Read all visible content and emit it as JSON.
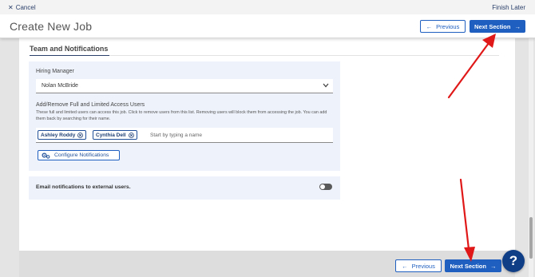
{
  "topbar": {
    "cancel_label": "Cancel",
    "finish_label": "Finish Later"
  },
  "header": {
    "title": "Create New Job",
    "previous_label": "Previous",
    "next_label": "Next Section"
  },
  "section": {
    "title": "Team and Notifications"
  },
  "hiring_manager": {
    "label": "Hiring Manager",
    "value": "Nolan McBride"
  },
  "access_users": {
    "label": "Add/Remove Full and Limited Access Users",
    "help": "These full and limited users can access this job. Click to remove users from this list. Removing users will block them from accessing the job. You can add them back by searching for their name.",
    "chips": [
      "Ashley Roddy",
      "Cynthia Dell"
    ],
    "placeholder": "Start by typing a name"
  },
  "configure_label": "Configure Notifications",
  "email_toggle": {
    "label": "Email notifications to external users.",
    "enabled": false
  },
  "footer": {
    "previous_label": "Previous",
    "next_label": "Next Section"
  },
  "help_fab": {
    "glyph": "?"
  },
  "colors": {
    "primary": "#1f5fbf",
    "panel_bg": "#eef3fb",
    "annotation_arrow": "#e01818",
    "fab": "#0f3d86"
  }
}
